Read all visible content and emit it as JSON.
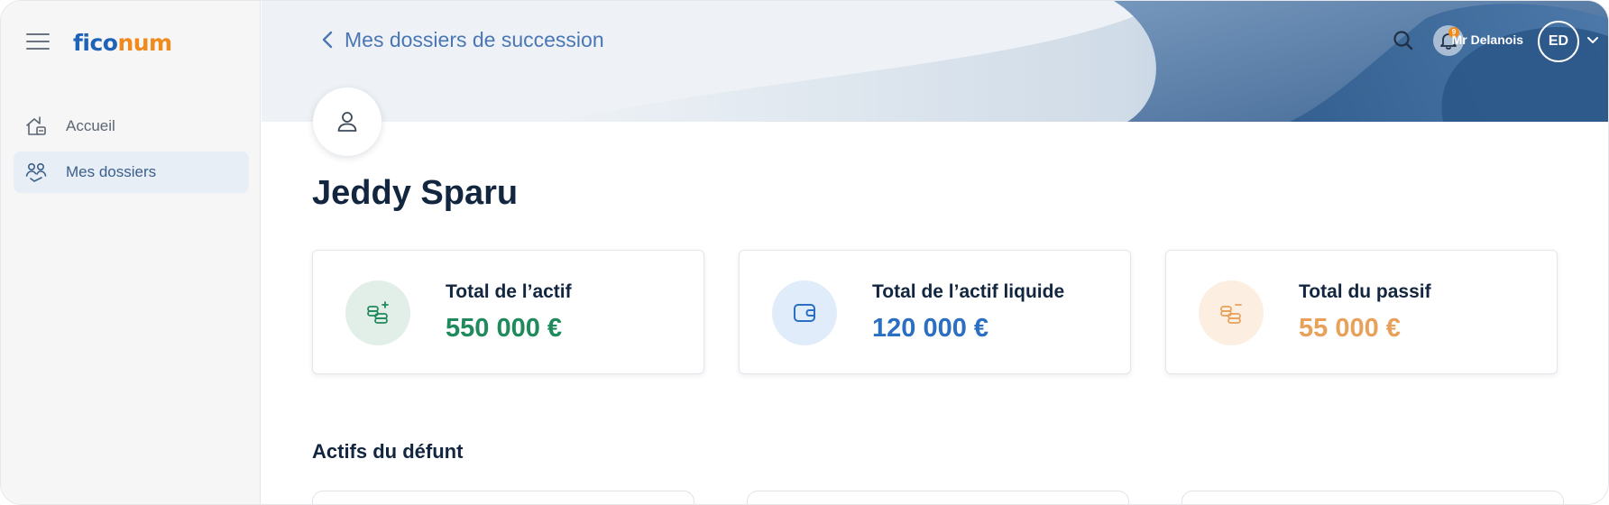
{
  "sidebar": {
    "logo": {
      "part1": "fico",
      "part2": "num"
    },
    "items": [
      {
        "label": "Accueil",
        "icon": "home-icon"
      },
      {
        "label": "Mes dossiers",
        "icon": "users-icon"
      }
    ]
  },
  "header": {
    "back_label": "Mes dossiers de succession",
    "notification_count": "9",
    "user_name": "Mr Delanois",
    "user_initials": "ED"
  },
  "profile": {
    "name": "Jeddy Sparu"
  },
  "cards": [
    {
      "label": "Total de l’actif",
      "value": "550 000 €",
      "color": "#1f8a5b",
      "icon_bg": "#e1efe8"
    },
    {
      "label": "Total de l’actif liquide",
      "value": "120 000 €",
      "color": "#2a6fc1",
      "icon_bg": "#e0ecfa"
    },
    {
      "label": "Total du passif",
      "value": "55 000 €",
      "color": "#e8a15b",
      "icon_bg": "#fcefe2"
    }
  ],
  "section": {
    "title": "Actifs du défunt"
  },
  "colors": {
    "brand_blue": "#1e63b8",
    "brand_orange": "#f08a1d",
    "title": "#12263f"
  }
}
